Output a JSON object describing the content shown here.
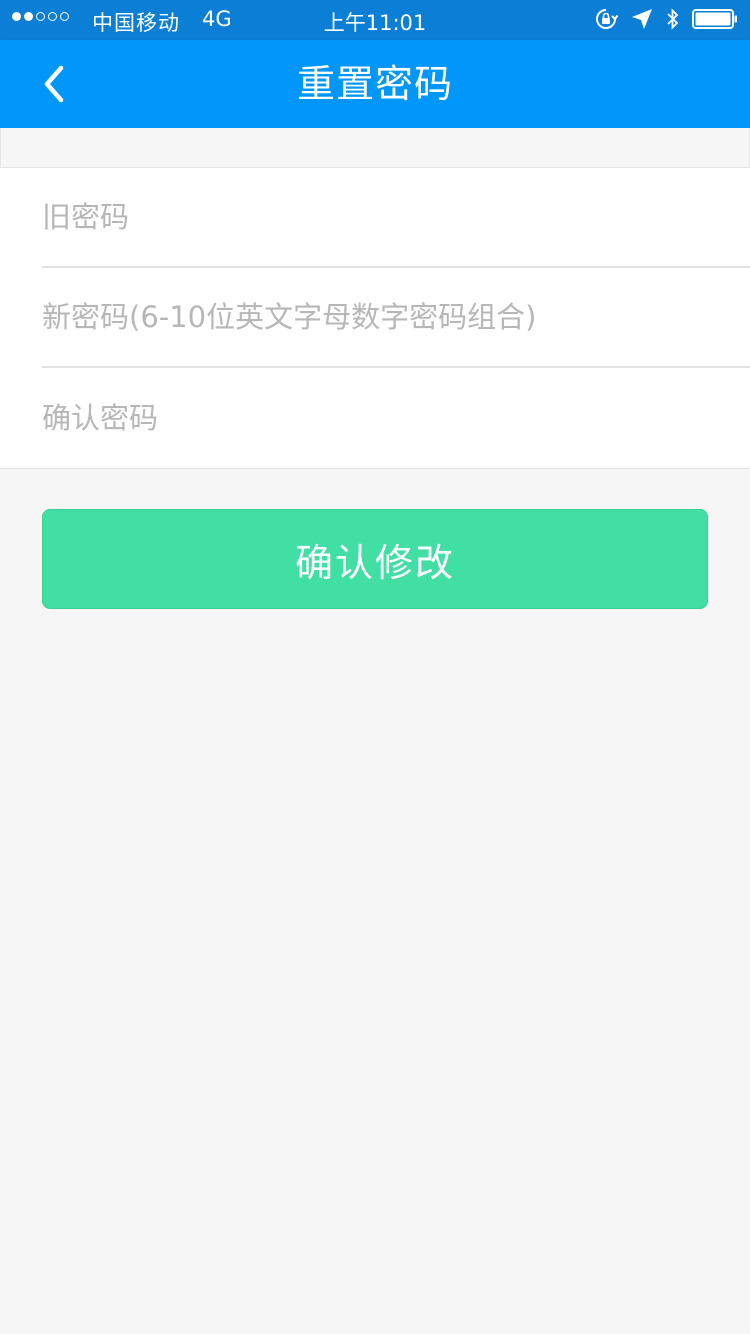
{
  "status_bar": {
    "signal_dots_filled": 2,
    "signal_dots_total": 5,
    "carrier": "中国移动",
    "network": "4G",
    "time": "上午11:01",
    "icons": [
      "orientation-lock-icon",
      "location-icon",
      "bluetooth-icon",
      "battery-icon"
    ],
    "battery_level": 1.0
  },
  "nav_bar": {
    "back_icon": "chevron-left-icon",
    "title": "重置密码",
    "color": "#0096fa"
  },
  "form": {
    "old_password": {
      "value": "",
      "placeholder": "旧密码"
    },
    "new_password": {
      "value": "",
      "placeholder": "新密码(6-10位英文字母数字密码组合)"
    },
    "confirm_password": {
      "value": "",
      "placeholder": "确认密码"
    }
  },
  "submit": {
    "label": "确认修改",
    "color": "#41dfa4"
  }
}
